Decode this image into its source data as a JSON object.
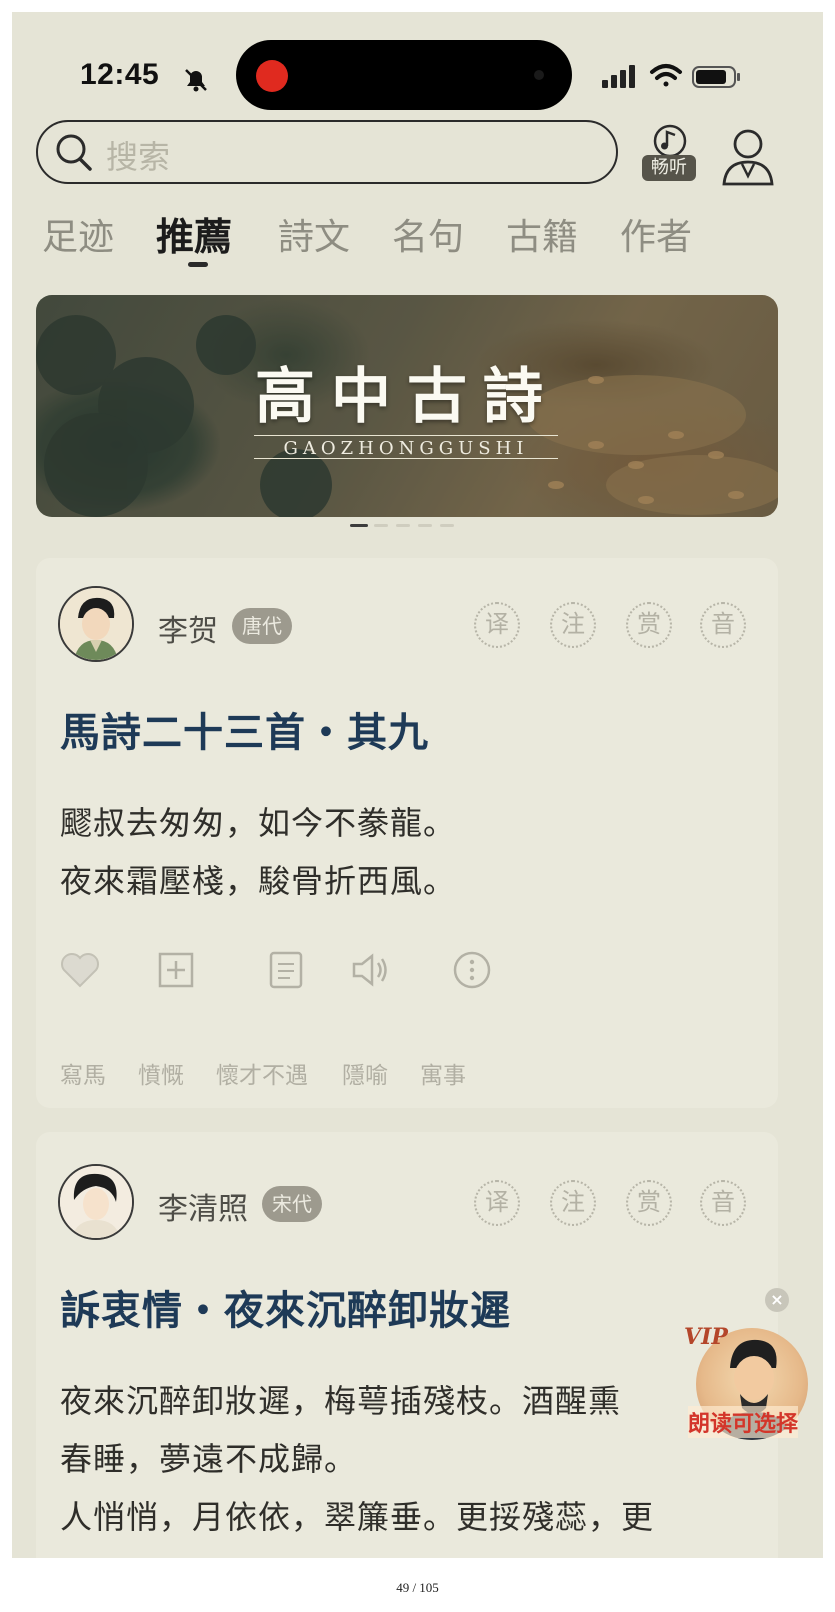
{
  "status_bar": {
    "time": "12:45"
  },
  "header": {
    "search_placeholder": "搜索",
    "listen_label": "畅听"
  },
  "tabs": [
    {
      "label": "足迹",
      "active": false
    },
    {
      "label": "推薦",
      "active": true
    },
    {
      "label": "詩文",
      "active": false
    },
    {
      "label": "名句",
      "active": false
    },
    {
      "label": "古籍",
      "active": false
    },
    {
      "label": "作者",
      "active": false
    }
  ],
  "banner": {
    "title": "高中古詩",
    "subtitle": "GAOZHONGGUSHI",
    "pages": 5,
    "current_page": 1
  },
  "action_seals": [
    "译",
    "注",
    "赏",
    "音"
  ],
  "cards": [
    {
      "author": "李贺",
      "dynasty": "唐代",
      "title": "馬詩二十三首・其九",
      "lines": [
        "飂叔去匆匆，如今不豢龍。",
        "夜來霜壓棧，駿骨折西風。"
      ],
      "tags": [
        "寫馬",
        "憤慨",
        "懷才不遇",
        "隱喻",
        "寓事"
      ]
    },
    {
      "author": "李清照",
      "dynasty": "宋代",
      "title": "訴衷情・夜來沉醉卸妝遲",
      "lines": [
        "夜來沉醉卸妝遲，梅萼插殘枝。酒醒熏",
        "春睡，夢遠不成歸。",
        "人悄悄，月依依，翠簾垂。更挼殘蕊，更"
      ]
    }
  ],
  "floating": {
    "badge": "VIP",
    "label": "朗读可选择"
  },
  "page_number": "49 / 105",
  "colors": {
    "background": "#e5e4d6",
    "card": "#eae9dc",
    "title": "#1e3a57",
    "tag": "#b1afa3"
  }
}
